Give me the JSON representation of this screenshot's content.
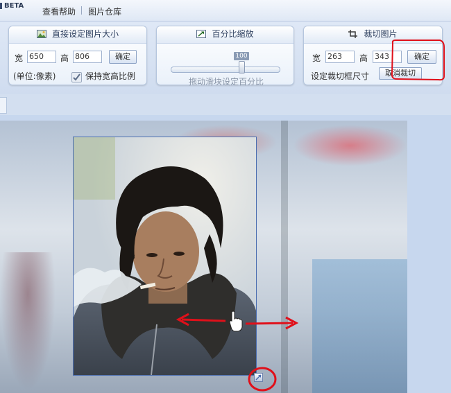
{
  "app": {
    "badge": "BETA"
  },
  "menu": {
    "help": "查看帮助",
    "gallery": "图片仓库"
  },
  "resize_panel": {
    "title": "直接设定图片大小",
    "width_label": "宽",
    "width_value": "650",
    "height_label": "高",
    "height_value": "806",
    "confirm_label": "确定",
    "unit_note": "(单位:像素)",
    "keep_ratio_label": "保持宽高比例"
  },
  "scale_panel": {
    "title": "百分比缩放",
    "value": "100",
    "hint": "拖动滑块设定百分比"
  },
  "crop_panel": {
    "title": "裁切图片",
    "width_label": "宽",
    "width_value": "263",
    "height_label": "高",
    "height_value": "343",
    "confirm_label": "确定",
    "size_hint": "设定裁切框尺寸",
    "cancel_label": "取消裁切"
  },
  "colors": {
    "accent": "#4a6db0",
    "annotation_red": "#e0101a",
    "toolbar_bg": "#dfe8f6"
  },
  "icons": [
    "image-icon",
    "resize-arrow-icon",
    "crop-icon",
    "checkmark-icon",
    "hand-cursor-icon"
  ]
}
